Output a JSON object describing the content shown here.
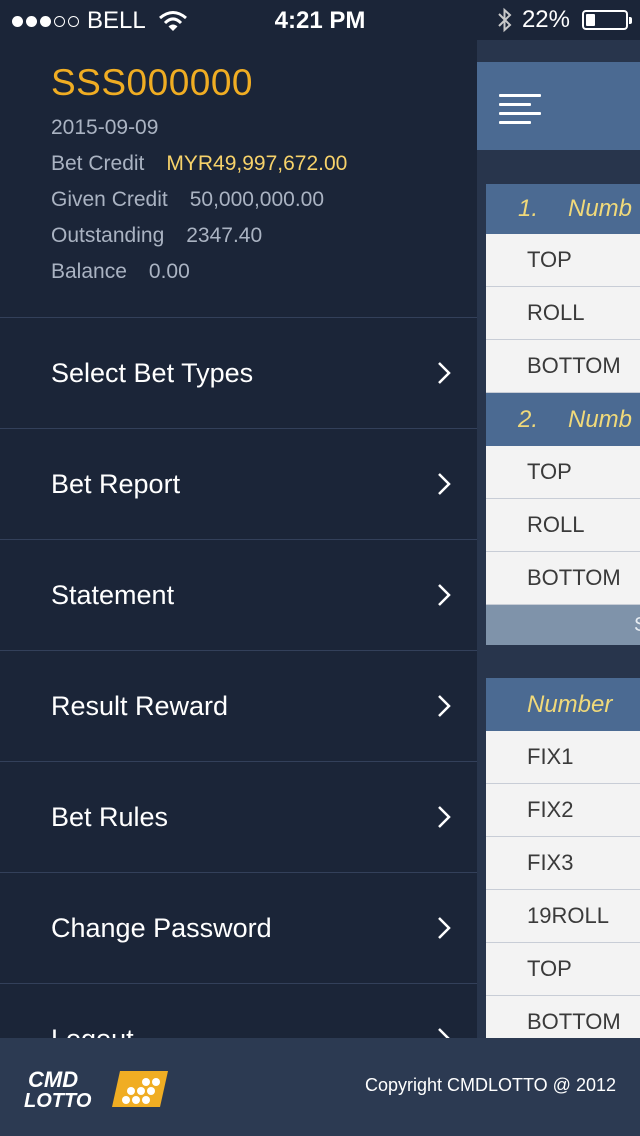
{
  "status": {
    "carrier": "BELL",
    "time": "4:21 PM",
    "battery": "22%"
  },
  "account": {
    "id": "SSS000000",
    "date": "2015-09-09",
    "rows": [
      {
        "label": "Bet Credit",
        "value": "MYR49,997,672.00"
      },
      {
        "label": "Given Credit",
        "value": "50,000,000.00"
      },
      {
        "label": "Outstanding",
        "value": "2347.40"
      },
      {
        "label": "Balance",
        "value": "0.00"
      }
    ]
  },
  "menu": {
    "items": [
      {
        "label": "Select Bet Types"
      },
      {
        "label": "Bet Report"
      },
      {
        "label": "Statement"
      },
      {
        "label": "Result Reward"
      },
      {
        "label": "Bet Rules"
      },
      {
        "label": "Change Password"
      },
      {
        "label": "Logout"
      }
    ]
  },
  "content": {
    "table1": {
      "sections": [
        {
          "index": "1.",
          "title": "Numb",
          "rows": [
            "TOP",
            "ROLL",
            "BOTTOM"
          ]
        },
        {
          "index": "2.",
          "title": "Numb",
          "rows": [
            "TOP",
            "ROLL",
            "BOTTOM"
          ]
        }
      ],
      "footer_text": "S"
    },
    "table2": {
      "header": "Number",
      "rows": [
        "FIX1",
        "FIX2",
        "FIX3",
        "19ROLL",
        "TOP",
        "BOTTOM"
      ]
    }
  },
  "footer": {
    "logo_text_1": "CMD",
    "logo_text_2": "LOTTO",
    "copyright": "Copyright CMDLOTTO @ 2012"
  },
  "colors": {
    "accent_gold": "#f0ad23",
    "credit_gold": "#f7d26a",
    "panel_bg": "#1b2538",
    "header_blue": "#4b6a92"
  }
}
